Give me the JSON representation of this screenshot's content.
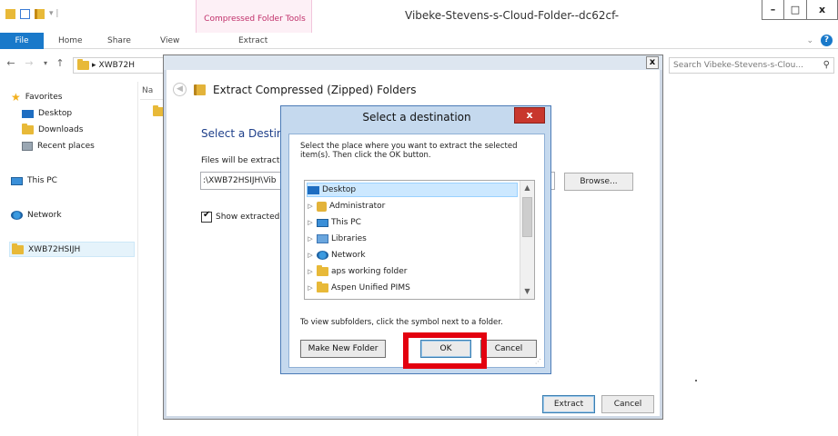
{
  "window": {
    "title": "Vibeke-Stevens-s-Cloud-Folder--dc62cf-",
    "contextual_tab": "Compressed Folder Tools",
    "min_symbol": "–",
    "max_symbol": "□",
    "close_symbol": "x"
  },
  "ribbon": {
    "file": "File",
    "tabs": [
      "Home",
      "Share",
      "View",
      "Extract"
    ],
    "chevron": "⌄",
    "help": "?"
  },
  "address": {
    "back": "←",
    "forward": "→",
    "down": "▾",
    "up": "↑",
    "separator": "▸",
    "path": "XWB72H",
    "search_placeholder": "Search Vibeke-Stevens-s-Clou...",
    "search_icon": "⚲"
  },
  "nav": {
    "favorites": "Favorites",
    "desktop": "Desktop",
    "downloads": "Downloads",
    "recent": "Recent places",
    "this_pc": "This PC",
    "network": "Network",
    "folder": "XWB72HSIJH",
    "column_header": "Na"
  },
  "wizard": {
    "close": "x",
    "back": "◀",
    "title": "Extract Compressed (Zipped) Folders",
    "heading": "Select a Destin",
    "files_label": "Files will be extracte",
    "path": ":\\XWB72HSIJH\\Vib",
    "browse": "Browse...",
    "show_files": "Show extracted f",
    "extract": "Extract",
    "cancel": "Cancel"
  },
  "dialog": {
    "title": "Select a destination",
    "close": "x",
    "description": "Select the place where you want to extract the selected item(s).  Then click the OK button.",
    "tree": [
      {
        "label": "Desktop",
        "expander": ""
      },
      {
        "label": "Administrator",
        "expander": "▷"
      },
      {
        "label": "This PC",
        "expander": "▷"
      },
      {
        "label": "Libraries",
        "expander": "▷"
      },
      {
        "label": "Network",
        "expander": "▷"
      },
      {
        "label": "aps working folder",
        "expander": "▷"
      },
      {
        "label": "Aspen Unified PIMS",
        "expander": "▷"
      }
    ],
    "scroll_up": "▲",
    "scroll_down": "▼",
    "hint": "To view subfolders, click the symbol next to a folder.",
    "make_new_folder": "Make New Folder",
    "ok": "OK",
    "cancel": "Cancel"
  },
  "colors": {
    "accent": "#1979ca",
    "highlight": "#e3000f",
    "dialog_frame": "#c5d9ee"
  }
}
